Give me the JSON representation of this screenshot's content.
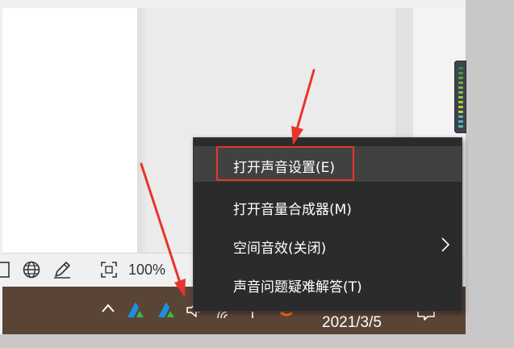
{
  "status_bar": {
    "zoom_text": "100%",
    "icons": [
      "page-layout-icon",
      "web-layout-icon",
      "ink-icon",
      "focus-icon"
    ]
  },
  "context_menu": {
    "items": [
      {
        "label": "打开声音设置(E)",
        "highlighted": true,
        "submenu": false
      },
      {
        "label": "打开音量合成器(M)",
        "highlighted": false,
        "submenu": false
      },
      {
        "label": "空间音效(关闭)",
        "highlighted": false,
        "submenu": true
      },
      {
        "label": "声音问题疑难解答(T)",
        "highlighted": false,
        "submenu": false
      }
    ]
  },
  "taskbar": {
    "date": "2021/3/5",
    "tray_icons": [
      "chevron-up-icon",
      "app-a-icon",
      "app-a-icon",
      "speaker-icon",
      "network-icon",
      "power-icon",
      "input-method-icon",
      "notification-icon"
    ]
  },
  "colors": {
    "highlight": "#e8342c",
    "arrow": "#e8342c",
    "menu_bg": "#2b2b2b",
    "taskbar_bg": "#5a4436"
  }
}
